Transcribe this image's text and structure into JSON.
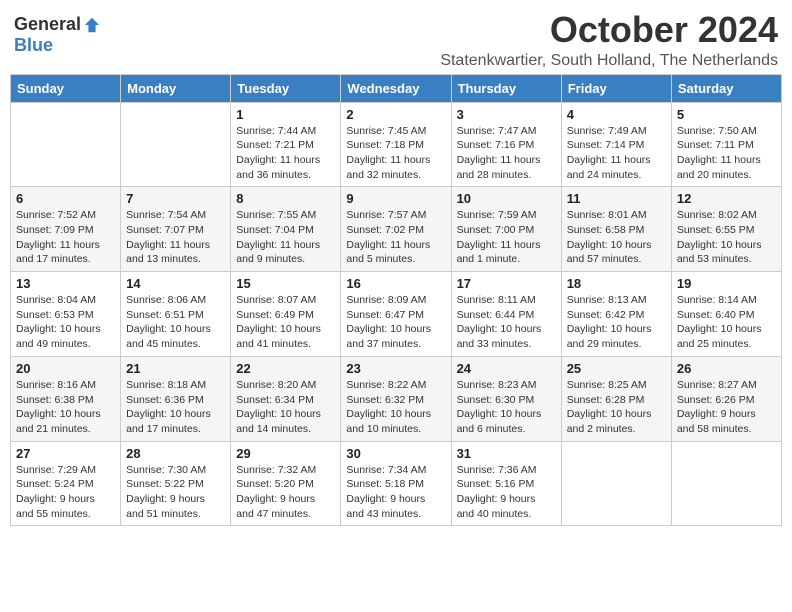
{
  "header": {
    "logo_general": "General",
    "logo_blue": "Blue",
    "month": "October 2024",
    "location": "Statenkwartier, South Holland, The Netherlands"
  },
  "weekdays": [
    "Sunday",
    "Monday",
    "Tuesday",
    "Wednesday",
    "Thursday",
    "Friday",
    "Saturday"
  ],
  "weeks": [
    [
      {
        "day": "",
        "sunrise": "",
        "sunset": "",
        "daylight": ""
      },
      {
        "day": "",
        "sunrise": "",
        "sunset": "",
        "daylight": ""
      },
      {
        "day": "1",
        "sunrise": "Sunrise: 7:44 AM",
        "sunset": "Sunset: 7:21 PM",
        "daylight": "Daylight: 11 hours and 36 minutes."
      },
      {
        "day": "2",
        "sunrise": "Sunrise: 7:45 AM",
        "sunset": "Sunset: 7:18 PM",
        "daylight": "Daylight: 11 hours and 32 minutes."
      },
      {
        "day": "3",
        "sunrise": "Sunrise: 7:47 AM",
        "sunset": "Sunset: 7:16 PM",
        "daylight": "Daylight: 11 hours and 28 minutes."
      },
      {
        "day": "4",
        "sunrise": "Sunrise: 7:49 AM",
        "sunset": "Sunset: 7:14 PM",
        "daylight": "Daylight: 11 hours and 24 minutes."
      },
      {
        "day": "5",
        "sunrise": "Sunrise: 7:50 AM",
        "sunset": "Sunset: 7:11 PM",
        "daylight": "Daylight: 11 hours and 20 minutes."
      }
    ],
    [
      {
        "day": "6",
        "sunrise": "Sunrise: 7:52 AM",
        "sunset": "Sunset: 7:09 PM",
        "daylight": "Daylight: 11 hours and 17 minutes."
      },
      {
        "day": "7",
        "sunrise": "Sunrise: 7:54 AM",
        "sunset": "Sunset: 7:07 PM",
        "daylight": "Daylight: 11 hours and 13 minutes."
      },
      {
        "day": "8",
        "sunrise": "Sunrise: 7:55 AM",
        "sunset": "Sunset: 7:04 PM",
        "daylight": "Daylight: 11 hours and 9 minutes."
      },
      {
        "day": "9",
        "sunrise": "Sunrise: 7:57 AM",
        "sunset": "Sunset: 7:02 PM",
        "daylight": "Daylight: 11 hours and 5 minutes."
      },
      {
        "day": "10",
        "sunrise": "Sunrise: 7:59 AM",
        "sunset": "Sunset: 7:00 PM",
        "daylight": "Daylight: 11 hours and 1 minute."
      },
      {
        "day": "11",
        "sunrise": "Sunrise: 8:01 AM",
        "sunset": "Sunset: 6:58 PM",
        "daylight": "Daylight: 10 hours and 57 minutes."
      },
      {
        "day": "12",
        "sunrise": "Sunrise: 8:02 AM",
        "sunset": "Sunset: 6:55 PM",
        "daylight": "Daylight: 10 hours and 53 minutes."
      }
    ],
    [
      {
        "day": "13",
        "sunrise": "Sunrise: 8:04 AM",
        "sunset": "Sunset: 6:53 PM",
        "daylight": "Daylight: 10 hours and 49 minutes."
      },
      {
        "day": "14",
        "sunrise": "Sunrise: 8:06 AM",
        "sunset": "Sunset: 6:51 PM",
        "daylight": "Daylight: 10 hours and 45 minutes."
      },
      {
        "day": "15",
        "sunrise": "Sunrise: 8:07 AM",
        "sunset": "Sunset: 6:49 PM",
        "daylight": "Daylight: 10 hours and 41 minutes."
      },
      {
        "day": "16",
        "sunrise": "Sunrise: 8:09 AM",
        "sunset": "Sunset: 6:47 PM",
        "daylight": "Daylight: 10 hours and 37 minutes."
      },
      {
        "day": "17",
        "sunrise": "Sunrise: 8:11 AM",
        "sunset": "Sunset: 6:44 PM",
        "daylight": "Daylight: 10 hours and 33 minutes."
      },
      {
        "day": "18",
        "sunrise": "Sunrise: 8:13 AM",
        "sunset": "Sunset: 6:42 PM",
        "daylight": "Daylight: 10 hours and 29 minutes."
      },
      {
        "day": "19",
        "sunrise": "Sunrise: 8:14 AM",
        "sunset": "Sunset: 6:40 PM",
        "daylight": "Daylight: 10 hours and 25 minutes."
      }
    ],
    [
      {
        "day": "20",
        "sunrise": "Sunrise: 8:16 AM",
        "sunset": "Sunset: 6:38 PM",
        "daylight": "Daylight: 10 hours and 21 minutes."
      },
      {
        "day": "21",
        "sunrise": "Sunrise: 8:18 AM",
        "sunset": "Sunset: 6:36 PM",
        "daylight": "Daylight: 10 hours and 17 minutes."
      },
      {
        "day": "22",
        "sunrise": "Sunrise: 8:20 AM",
        "sunset": "Sunset: 6:34 PM",
        "daylight": "Daylight: 10 hours and 14 minutes."
      },
      {
        "day": "23",
        "sunrise": "Sunrise: 8:22 AM",
        "sunset": "Sunset: 6:32 PM",
        "daylight": "Daylight: 10 hours and 10 minutes."
      },
      {
        "day": "24",
        "sunrise": "Sunrise: 8:23 AM",
        "sunset": "Sunset: 6:30 PM",
        "daylight": "Daylight: 10 hours and 6 minutes."
      },
      {
        "day": "25",
        "sunrise": "Sunrise: 8:25 AM",
        "sunset": "Sunset: 6:28 PM",
        "daylight": "Daylight: 10 hours and 2 minutes."
      },
      {
        "day": "26",
        "sunrise": "Sunrise: 8:27 AM",
        "sunset": "Sunset: 6:26 PM",
        "daylight": "Daylight: 9 hours and 58 minutes."
      }
    ],
    [
      {
        "day": "27",
        "sunrise": "Sunrise: 7:29 AM",
        "sunset": "Sunset: 5:24 PM",
        "daylight": "Daylight: 9 hours and 55 minutes."
      },
      {
        "day": "28",
        "sunrise": "Sunrise: 7:30 AM",
        "sunset": "Sunset: 5:22 PM",
        "daylight": "Daylight: 9 hours and 51 minutes."
      },
      {
        "day": "29",
        "sunrise": "Sunrise: 7:32 AM",
        "sunset": "Sunset: 5:20 PM",
        "daylight": "Daylight: 9 hours and 47 minutes."
      },
      {
        "day": "30",
        "sunrise": "Sunrise: 7:34 AM",
        "sunset": "Sunset: 5:18 PM",
        "daylight": "Daylight: 9 hours and 43 minutes."
      },
      {
        "day": "31",
        "sunrise": "Sunrise: 7:36 AM",
        "sunset": "Sunset: 5:16 PM",
        "daylight": "Daylight: 9 hours and 40 minutes."
      },
      {
        "day": "",
        "sunrise": "",
        "sunset": "",
        "daylight": ""
      },
      {
        "day": "",
        "sunrise": "",
        "sunset": "",
        "daylight": ""
      }
    ]
  ]
}
